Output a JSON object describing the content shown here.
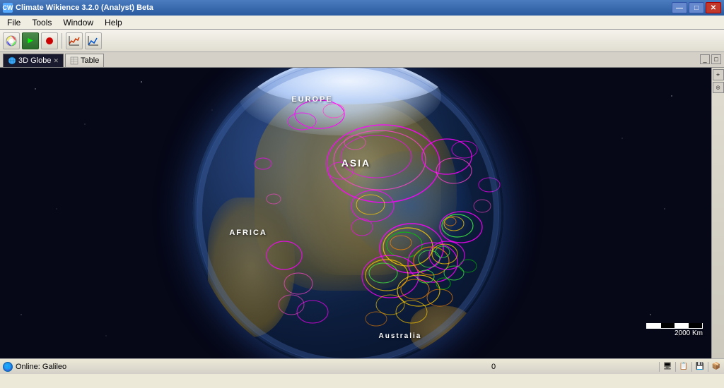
{
  "titlebar": {
    "title": "Climate Wikience 3.2.0 (Analyst) Beta",
    "icon_label": "CW",
    "minimize_label": "—",
    "maximize_label": "□",
    "close_label": "✕"
  },
  "menubar": {
    "items": [
      {
        "label": "File",
        "id": "menu-file"
      },
      {
        "label": "Tools",
        "id": "menu-tools"
      },
      {
        "label": "Window",
        "id": "menu-window"
      },
      {
        "label": "Help",
        "id": "menu-help"
      }
    ]
  },
  "toolbar": {
    "buttons": [
      {
        "icon": "🎨",
        "name": "color-wheel-button",
        "tooltip": "Color"
      },
      {
        "icon": "▶",
        "name": "play-button",
        "tooltip": "Play",
        "active": true
      },
      {
        "icon": "⏹",
        "name": "stop-button",
        "tooltip": "Stop"
      },
      {
        "icon": "📈",
        "name": "chart-button",
        "tooltip": "Chart"
      },
      {
        "icon": "📉",
        "name": "line-chart-button",
        "tooltip": "Line Chart"
      }
    ]
  },
  "tabs": [
    {
      "label": "3D Globe",
      "id": "tab-3d-globe",
      "active": true,
      "closable": true
    },
    {
      "label": "Table",
      "id": "tab-table",
      "active": false,
      "closable": false
    }
  ],
  "globe": {
    "labels": [
      {
        "text": "EUROPE",
        "style": "top:12%; left:32%;"
      },
      {
        "text": "ASIA",
        "style": "top:30%; left:48%;"
      },
      {
        "text": "AFRICA",
        "style": "top:55%; left:14%;"
      },
      {
        "text": "Australia",
        "style": "bottom:8%; left:62%;"
      }
    ]
  },
  "scale_bar": {
    "label": "2000 Km"
  },
  "statusbar": {
    "online_label": "Online: Galileo",
    "coordinate_value": "0",
    "icons": [
      "🖥",
      "📋",
      "💾",
      "📦"
    ]
  }
}
